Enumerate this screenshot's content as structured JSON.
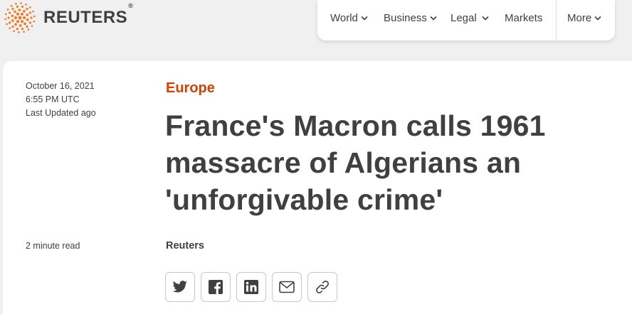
{
  "brand": {
    "name": "REUTERS",
    "registered": "®",
    "accent_color": "#d64000",
    "logo_dot_color": "#f07a22"
  },
  "nav": {
    "items": [
      {
        "label": "World",
        "has_dropdown": true
      },
      {
        "label": "Business",
        "has_dropdown": true
      },
      {
        "label": "Legal",
        "has_dropdown": true
      },
      {
        "label": "Markets",
        "has_dropdown": false
      },
      {
        "label": "More",
        "has_dropdown": true
      }
    ]
  },
  "article": {
    "date": "October 16, 2021",
    "time": "6:55 PM UTC",
    "last_updated": "Last Updated ago",
    "read_time": "2 minute read",
    "section": "Europe",
    "headline": "France's Macron calls 1961 massacre of Algerians an 'unforgivable crime'",
    "byline": "Reuters"
  },
  "share": {
    "buttons": [
      {
        "icon": "twitter-icon"
      },
      {
        "icon": "facebook-icon"
      },
      {
        "icon": "linkedin-icon"
      },
      {
        "icon": "email-icon"
      },
      {
        "icon": "link-icon"
      }
    ]
  }
}
